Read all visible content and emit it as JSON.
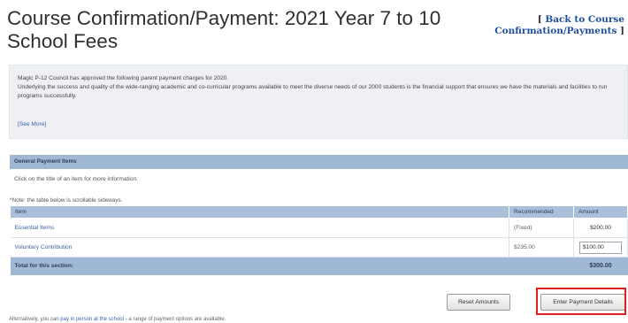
{
  "page": {
    "title": "Course Confirmation/Payment: 2021 Year 7 to 10 School Fees",
    "back_link_open": "[",
    "back_link_label": "Back to Course Confirmation/Payments",
    "back_link_close": "]"
  },
  "intro": {
    "line1": "Magic P-12 Council has approved the following parent payment charges for 2020.",
    "line2": "Underlying the success and quality of the wide-ranging academic and co-curricular programs available to meet the diverse needs of our 2000 students is the financial support that ensures we have the materials and facilities to run programs successfully.",
    "see_more": "[See More]"
  },
  "section": {
    "header": "General Payment Items",
    "click_note": "Click on the title of an item for more information.",
    "scroll_note": "*Note: the table below is scrollable sideways."
  },
  "table": {
    "columns": {
      "item": "Item",
      "recommended": "Recommended",
      "amount": "Amount"
    },
    "rows": [
      {
        "item": "Essential Items",
        "recommended": "(Fixed)",
        "amount": "$200.00"
      },
      {
        "item": "Voluntary Contribution",
        "recommended": "$235.00",
        "amount": "$100.00"
      }
    ],
    "total_label": "Total for this section:",
    "total_value": "$300.00"
  },
  "buttons": {
    "reset": "Reset Amounts",
    "enter": "Enter Payment Details"
  },
  "footer": {
    "prefix": "Alternatively, you can",
    "link": "pay in person at the school",
    "suffix": "- a range of payment options are available."
  },
  "colors": {
    "accent_link": "#3a63a8",
    "header_blue": "#9fb8d6",
    "highlight_red": "#e02020"
  }
}
